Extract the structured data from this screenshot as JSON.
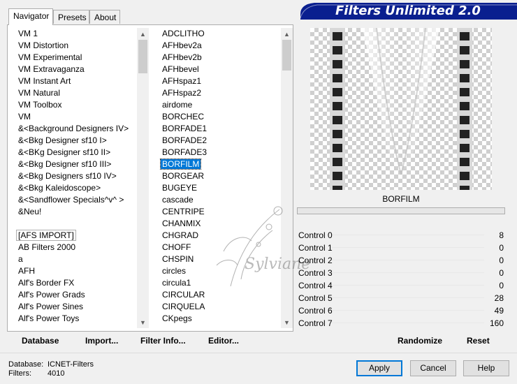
{
  "tabs": [
    {
      "label": "Navigator",
      "active": true
    },
    {
      "label": "Presets",
      "active": false
    },
    {
      "label": "About",
      "active": false
    }
  ],
  "app_title": "Filters Unlimited 2.0",
  "categories": [
    "VM 1",
    "VM Distortion",
    "VM Experimental",
    "VM Extravaganza",
    "VM Instant Art",
    "VM Natural",
    "VM Toolbox",
    "VM",
    "&<Background Designers IV>",
    "&<Bkg Designer sf10 I>",
    "&<BKg Designer sf10 II>",
    "&<Bkg Designer sf10 III>",
    "&<Bkg Designers sf10 IV>",
    "&<Bkg Kaleidoscope>",
    "&<Sandflower Specials^v^ >",
    "&Neu!",
    "",
    "[AFS IMPORT]",
    "AB Filters 2000",
    "a",
    "AFH",
    "Alf's Border FX",
    "Alf's Power Grads",
    "Alf's Power Sines",
    "Alf's Power Toys"
  ],
  "categories_boxed_index": 17,
  "filters": [
    "ADCLITHO",
    "AFHbev2a",
    "AFHbev2b",
    "AFHbevel",
    "AFHspaz1",
    "AFHspaz2",
    "airdome",
    "BORCHEC",
    "BORFADE1",
    "BORFADE2",
    "BORFADE3",
    "BORFILM",
    "BORGEAR",
    "BUGEYE",
    "cascade",
    "CENTRIPE",
    "CHANMIX",
    "CHGRAD",
    "CHOFF",
    "CHSPIN",
    "circles",
    "circula1",
    "CIRCULAR",
    "CIRQUELA",
    "CKpegs"
  ],
  "filters_selected_index": 11,
  "selected_filter": "BORFILM",
  "controls": [
    {
      "label": "Control 0",
      "value": "8"
    },
    {
      "label": "Control 1",
      "value": "0"
    },
    {
      "label": "Control 2",
      "value": "0"
    },
    {
      "label": "Control 3",
      "value": "0"
    },
    {
      "label": "Control 4",
      "value": "0"
    },
    {
      "label": "Control 5",
      "value": "28"
    },
    {
      "label": "Control 6",
      "value": "49"
    },
    {
      "label": "Control 7",
      "value": "160"
    }
  ],
  "buttons": {
    "database": "Database",
    "import": "Import...",
    "filter_info": "Filter Info...",
    "editor": "Editor...",
    "randomize": "Randomize",
    "reset": "Reset",
    "apply": "Apply",
    "cancel": "Cancel",
    "help": "Help"
  },
  "status": {
    "database_label": "Database:",
    "database_value": "ICNET-Filters",
    "filters_label": "Filters:",
    "filters_value": "4010"
  },
  "watermark_text": "Sylviane",
  "colors": {
    "title_bg": "#0a1f8f",
    "selection": "#0078d7"
  }
}
